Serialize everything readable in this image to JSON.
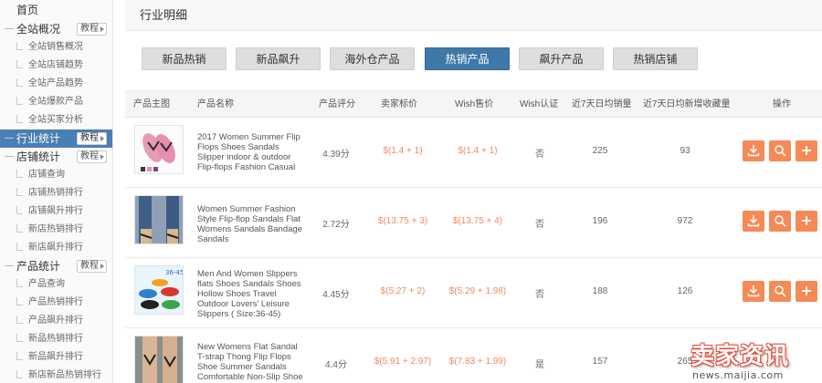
{
  "sidebar": {
    "home": "首页",
    "groups": [
      {
        "title": "全站概况",
        "tutorial": "教程",
        "items": [
          "全站销售概况",
          "全站店铺趋势",
          "全站产品趋势",
          "全站爆款产品",
          "全站买家分析"
        ]
      },
      {
        "title": "行业统计",
        "tutorial": "教程",
        "active": true,
        "items": []
      },
      {
        "title": "店铺统计",
        "tutorial": "教程",
        "items": [
          "店铺查询",
          "店铺热销排行",
          "店铺飙升排行",
          "新店热销排行",
          "新店飙升排行"
        ]
      },
      {
        "title": "产品统计",
        "tutorial": "教程",
        "items": [
          "产品查询",
          "产品热销排行",
          "产品飙升排行",
          "新品热销排行",
          "新品飙升排行",
          "新店新品热销排行"
        ]
      }
    ]
  },
  "main": {
    "title": "行业明细",
    "tabs": [
      "新品热销",
      "新品飙升",
      "海外仓产品",
      "热销产品",
      "飙升产品",
      "热销店铺"
    ],
    "active_tab": "热销产品",
    "columns": [
      "产品主图",
      "产品名称",
      "产品评分",
      "卖家标价",
      "Wish售价",
      "Wish认证",
      "近7天日均销量",
      "近7天日均新增收藏量",
      "操作"
    ],
    "rows": [
      {
        "name": "2017 Women Summer Flip Flops Shoes Sandals Slipper indoor & outdoor Flip-flops Fashion Casual",
        "rating": "4.39分",
        "seller_price": "$(1.4 + 1)",
        "wish_price": "$(1.4 + 1)",
        "verified": "否",
        "sales7": "225",
        "fav7": "93"
      },
      {
        "name": "Women Summer Fashion Style Flip-flop Sandals Flat Womens Sandals Bandage Sandals",
        "rating": "2.72分",
        "seller_price": "$(13.75 + 3)",
        "wish_price": "$(13.75 + 4)",
        "verified": "否",
        "sales7": "196",
        "fav7": "972"
      },
      {
        "name": "Men And Women Slippers flats Shoes Sandals Shoes Hollow Shoes Travel Outdoor Lovers' Leisure Slippers ( Size:36-45)",
        "rating": "4.45分",
        "seller_price": "$(5.27 + 2)",
        "wish_price": "$(5.29 + 1.98)",
        "verified": "否",
        "sales7": "188",
        "fav7": "126"
      },
      {
        "name": "New Womens Flat Sandal T-strap Thong Flip Flops Shoe Summer Sandals Comfortable Non-Slip Shoe",
        "rating": "4.4分",
        "seller_price": "$(5.91 + 2.97)",
        "wish_price": "$(7.83 + 1.99)",
        "verified": "是",
        "sales7": "157",
        "fav7": "265"
      }
    ],
    "thumb_badge": "36-45"
  },
  "watermark": {
    "brand": "卖家资讯",
    "url": "news.maijia.com"
  },
  "colors": {
    "accent": "#3f77a8",
    "action": "#f58a57",
    "price": "#f08a5d",
    "watermark": "#e34a3a"
  }
}
